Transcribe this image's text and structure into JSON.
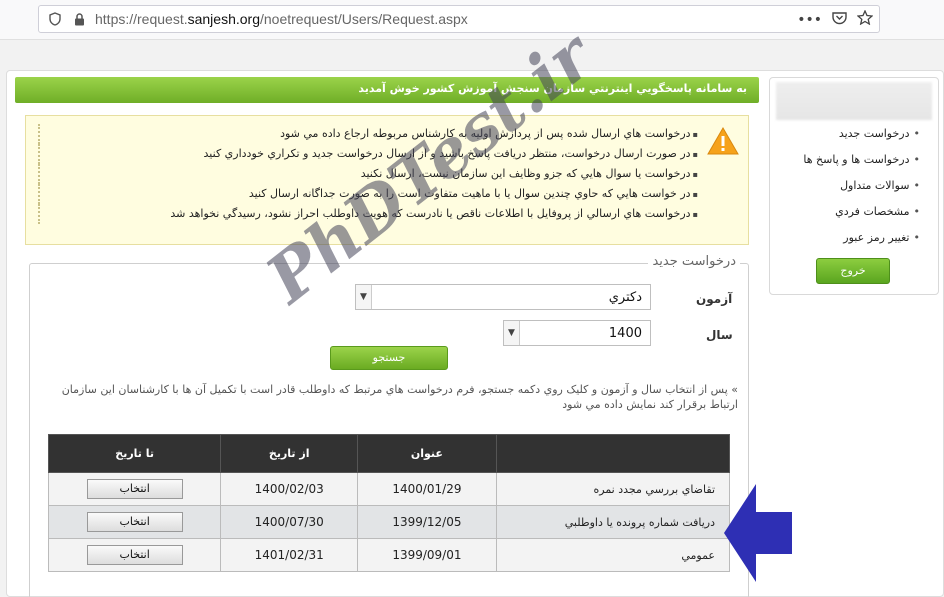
{
  "browser": {
    "url_prefix": "https://request.",
    "url_domain": "sanjesh.org",
    "url_path": "/noetrequest/Users/Request.aspx"
  },
  "sidebar": {
    "items": [
      "درخواست جديد",
      "درخواست ها و پاسخ ها",
      "سوالات متداول",
      "مشخصات فردي",
      "تغيير رمز عبور"
    ],
    "logout_label": "خروج"
  },
  "header": {
    "welcome": "به سامانه پاسخگويي اينترنتي سازمان سنجش آموزش کشور خوش آمديد"
  },
  "notice": {
    "items": [
      "درخواست هاي ارسال شده پس از پردازش اوليه به کارشناس مربوطه ارجاع داده مي شود",
      "در صورت ارسال درخواست، منتظر دريافت پاسخ باشيد و از ارسال درخواست جديد و تکراري خودداري کنيد",
      "درخواست يا سوال هايي که جزو وظايف اين سازمان نيست، ارسال نکنيد",
      "در خواست هايي که حاوي چندين سوال يا با ماهيت متفاوت است را به صورت جداگانه ارسال کنيد",
      "درخواست هاي ارسالي از پروفايل با اطلاعات ناقص يا نادرست که هويت داوطلب احراز نشود، رسيدگي نخواهد شد"
    ]
  },
  "form": {
    "legend": "درخواست جديد",
    "exam_label": "آزمون",
    "exam_value": "دکتري",
    "year_label": "سال",
    "year_value": "1400",
    "search_label": "جستجو",
    "hint": "» پس از انتخاب سال و آزمون و کليک روي دکمه جستجو، فرم درخواست هاي مرتبط که داوطلب قادر است با تکميل آن ها با کارشناسان اين سازمان ارتباط برقرار کند نمايش داده مي شود"
  },
  "table": {
    "headers": {
      "title": "عنوان",
      "from": "از تاريخ",
      "to": "تا تاريخ"
    },
    "pick_label": "انتخاب",
    "rows": [
      {
        "title": "تقاضاي بررسي مجدد نمره",
        "from": "1400/01/29",
        "to": "1400/02/03"
      },
      {
        "title": "دريافت شماره پرونده يا داوطلبي",
        "from": "1399/12/05",
        "to": "1400/07/30"
      },
      {
        "title": "عمومي",
        "from": "1399/09/01",
        "to": "1401/02/31"
      }
    ]
  },
  "watermark": "PhDTest.ir",
  "colors": {
    "accent_green": "#6fae27",
    "table_header": "#323232",
    "arrow_blue": "#2e2fb4"
  }
}
